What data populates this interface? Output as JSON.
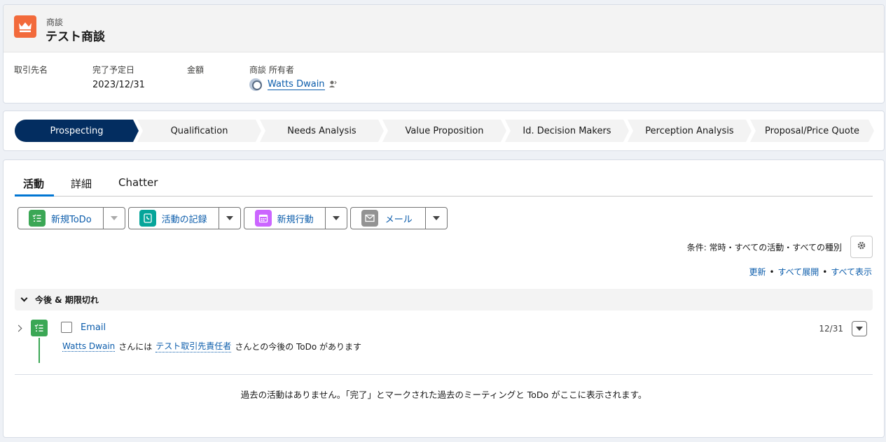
{
  "header": {
    "object_type": "商談",
    "record_name": "テスト商談",
    "fields": [
      {
        "label": "取引先名",
        "value": ""
      },
      {
        "label": "完了予定日",
        "value": "2023/12/31"
      },
      {
        "label": "金額",
        "value": ""
      },
      {
        "label": "商談 所有者",
        "value": "Watts Dwain"
      }
    ]
  },
  "path": {
    "stages": [
      "Prospecting",
      "Qualification",
      "Needs Analysis",
      "Value Proposition",
      "Id. Decision Makers",
      "Perception Analysis",
      "Proposal/Price Quote"
    ],
    "active_stage": "Prospecting"
  },
  "tabs": [
    "活動",
    "詳細",
    "Chatter"
  ],
  "active_tab": "活動",
  "actions": [
    {
      "label": "新規ToDo",
      "icon": "task-icon",
      "color": "#3ba755"
    },
    {
      "label": "活動の記録",
      "icon": "log-call-icon",
      "color": "#06a59a"
    },
    {
      "label": "新規行動",
      "icon": "calendar-icon",
      "color": "#cb65ff"
    },
    {
      "label": "メール",
      "icon": "email-icon",
      "color": "#939393"
    }
  ],
  "filter": {
    "text": "条件: 常時・すべての活動・すべての種別"
  },
  "links": {
    "refresh": "更新",
    "expand_all": "すべて展開",
    "show_all": "すべて表示"
  },
  "section": {
    "title": "今後 & 期限切れ"
  },
  "task": {
    "subject": "Email",
    "date": "12/31",
    "assignee": "Watts Dwain",
    "text_before": "さんには",
    "contact": "テスト取引先責任者",
    "text_after": "さんとの今後の ToDo があります"
  },
  "empty_message": "過去の活動はありません。「完了」とマークされた過去のミーティングと ToDo がここに表示されます。",
  "colors": {
    "accent": "#0176d3",
    "path_active": "#032d60",
    "opportunity_icon": "#f26a3b"
  }
}
